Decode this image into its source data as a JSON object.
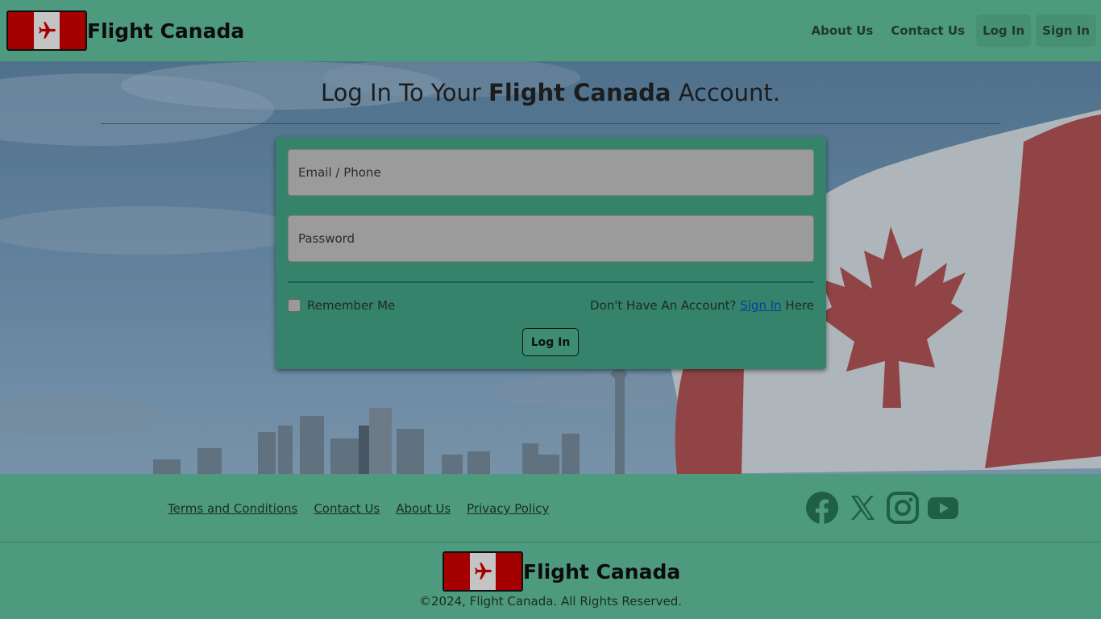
{
  "header": {
    "brand_name": "Flight Canada",
    "nav": [
      {
        "label": "About Us"
      },
      {
        "label": "Contact Us"
      },
      {
        "label": "Log In"
      },
      {
        "label": "Sign In"
      }
    ]
  },
  "hero": {
    "title_pre": "Log In To Your ",
    "title_bold": "Flight Canada",
    "title_post": " Account."
  },
  "form": {
    "email_placeholder": "Email / Phone",
    "password_placeholder": "Password",
    "remember_label": "Remember Me",
    "signup_prefix": "Don't Have An Account? ",
    "signup_link": "Sign In",
    "signup_suffix": " Here",
    "login_button": "Log In"
  },
  "footer": {
    "links": [
      {
        "label": "Terms and Conditions"
      },
      {
        "label": "Contact Us"
      },
      {
        "label": "About Us"
      },
      {
        "label": "Privacy Policy"
      }
    ],
    "socials": [
      "facebook-icon",
      "x-icon",
      "instagram-icon",
      "youtube-icon"
    ],
    "brand_name": "Flight Canada",
    "copyright": "©2024, Flight Canada. All Rights Reserved."
  },
  "colors": {
    "theme_green": "#4e9a7e",
    "card_green": "#34836a",
    "flag_red": "#a50000"
  }
}
